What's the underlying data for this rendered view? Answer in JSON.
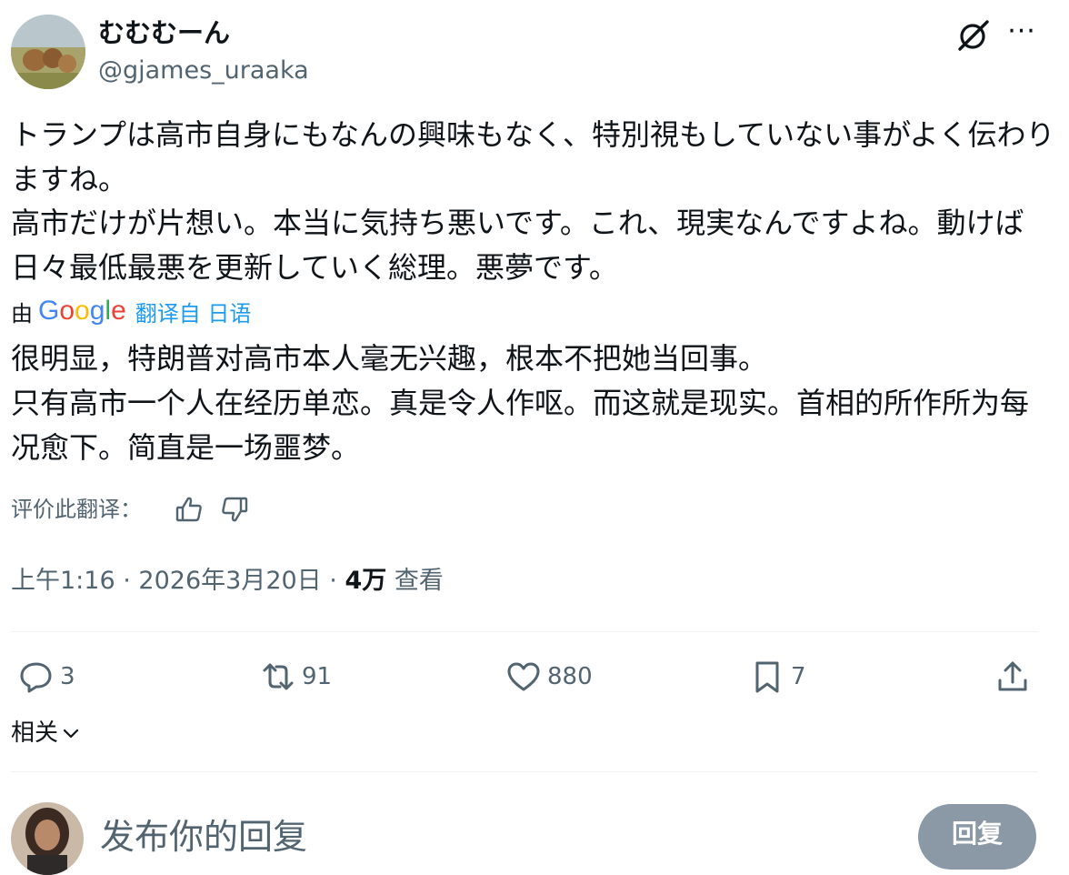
{
  "author": {
    "display_name": "むむむーん",
    "handle": "@gjames_uraaka"
  },
  "header": {
    "grok_icon": "grok-icon",
    "more_icon": "more-icon",
    "more_glyph": "···"
  },
  "tweet": {
    "original_text": "トランプは高市自身にもなんの興味もなく、特別視もしていない事がよく伝わりますね。\n高市だけが片想い。本当に気持ち悪いです。これ、現実なんですよね。動けば日々最低最悪を更新していく総理。悪夢です。",
    "translated_by_prefix": "由",
    "translated_by_provider": "Google",
    "translated_from_link": "翻译自 日语",
    "translation_text": "很明显，特朗普对高市本人毫无兴趣，根本不把她当回事。\n只有高市一个人在经历单恋。真是令人作呕。而这就是现实。首相的所作所为每况愈下。简直是一场噩梦。",
    "rate_translation_label": "评价此翻译："
  },
  "meta": {
    "time": "上午1:16",
    "separator": "·",
    "date": "2026年3月20日",
    "views_count": "4万",
    "views_label": "查看"
  },
  "actions": {
    "replies": "3",
    "reposts": "91",
    "likes": "880",
    "bookmarks": "7"
  },
  "related": {
    "label": "相关"
  },
  "reply_composer": {
    "placeholder": "发布你的回复",
    "button_label": "回复"
  },
  "colors": {
    "text_primary": "#0f1419",
    "text_secondary": "#536471",
    "link_blue": "#1d9bf0",
    "divider": "#eff3f4",
    "reply_button_disabled": "#8b98a5"
  }
}
